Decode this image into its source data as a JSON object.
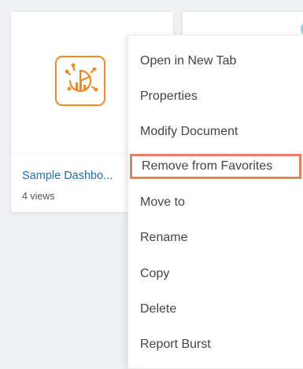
{
  "colors": {
    "accent_orange": "#f08a24",
    "link_blue": "#1d6fb8",
    "highlight_border": "#e6835d"
  },
  "cards": [
    {
      "icon": "dashboard-chart-icon",
      "title": "Sample Dashbo...",
      "views": "4 views"
    }
  ],
  "context_menu": {
    "items": [
      {
        "label": "Open in New Tab"
      },
      {
        "label": "Properties"
      },
      {
        "label": "Modify Document"
      },
      {
        "label": "Remove from Favorites",
        "highlighted": true
      },
      {
        "label": "Move to"
      },
      {
        "label": "Rename"
      },
      {
        "label": "Copy"
      },
      {
        "label": "Delete"
      },
      {
        "label": "Report Burst"
      }
    ]
  }
}
